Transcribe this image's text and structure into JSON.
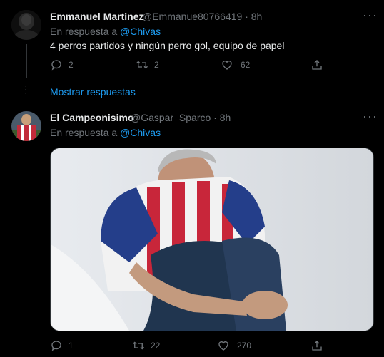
{
  "tweets": [
    {
      "name": "Emmanuel Martinez",
      "handle": "@Emmanue80766419",
      "sep": "·",
      "time": "8h",
      "reply_prefix": "En respuesta a",
      "reply_to": "@Chivas",
      "text": "4 perros partidos y ningún perro gol, equipo de papel",
      "replies": "2",
      "retweets": "2",
      "likes": "62"
    },
    {
      "name": "El Campeonisimo",
      "handle": "@Gaspar_Sparco",
      "sep": "·",
      "time": "8h",
      "reply_prefix": "En respuesta a",
      "reply_to": "@Chivas",
      "text": "",
      "replies": "1",
      "retweets": "22",
      "likes": "270"
    }
  ],
  "show_replies": "Mostrar respuestas",
  "colors": {
    "background": "#000000",
    "accent": "#1d9bf0",
    "muted": "#71767b"
  }
}
